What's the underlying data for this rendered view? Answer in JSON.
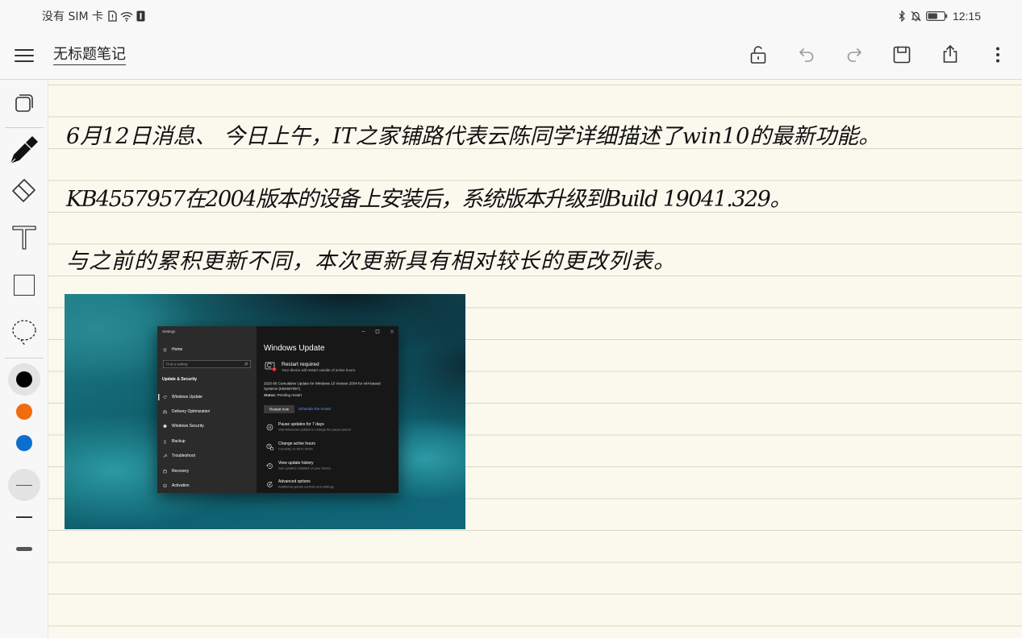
{
  "status_bar": {
    "carrier": "没有 SIM 卡",
    "time": "12:15",
    "battery_level": 0.6,
    "left_icons": [
      "sim-icon",
      "wifi-icon",
      "notification-icon"
    ],
    "right_icons": [
      "bluetooth-icon",
      "mute-icon",
      "battery-icon"
    ]
  },
  "toolbar": {
    "menu_icon": "menu-icon",
    "title": "无标题笔记",
    "actions": [
      "unlock-icon",
      "undo-icon",
      "redo-icon",
      "save-icon",
      "share-icon",
      "more-icon"
    ]
  },
  "tools": {
    "items": [
      "layers-icon",
      "pen-icon",
      "eraser-icon",
      "text-icon",
      "rectangle-icon",
      "lasso-icon"
    ],
    "selected": "pen-icon",
    "colors": [
      "#000000",
      "#f26b0f",
      "#0b6fce"
    ],
    "selected_color": "#000000",
    "stroke_widths": [
      "stroke-thin-icon",
      "stroke-medium-icon",
      "stroke-thick-icon"
    ],
    "selected_stroke": "stroke-thin-icon"
  },
  "theme": {
    "paper": "#fbf9ee",
    "rule": "#d9d6c6",
    "chrome": "#f8f8f8"
  },
  "note": {
    "lines": [
      "6月12日消息、 今日上午，IT之家铺路代表云陈同学详细描述了win10的最新功能。",
      "KB4557957在2004版本的设备上安装后，系统版本升级到Build 19041.329。",
      "与之前的累积更新不同，本次更新具有相对较长的更改列表。"
    ]
  },
  "embedded_image": {
    "window_title": "Settings",
    "window_controls": [
      "minimize-icon",
      "maximize-icon",
      "close-icon"
    ],
    "sidebar": {
      "home": "Home",
      "search_placeholder": "Find a setting",
      "section": "Update & Security",
      "items": [
        {
          "label": "Windows Update",
          "icon": "refresh-icon"
        },
        {
          "label": "Delivery Optimization",
          "icon": "delivery-icon"
        },
        {
          "label": "Windows Security",
          "icon": "shield-icon"
        },
        {
          "label": "Backup",
          "icon": "backup-icon"
        },
        {
          "label": "Troubleshoot",
          "icon": "wrench-icon"
        },
        {
          "label": "Recovery",
          "icon": "recovery-icon"
        },
        {
          "label": "Activation",
          "icon": "activation-icon"
        }
      ],
      "selected": "Windows Update"
    },
    "main": {
      "heading": "Windows Update",
      "restart_title": "Restart required",
      "restart_desc": "Your device will restart outside of active hours.",
      "update_name": "2020-06 Cumulative Update for Windows 10 Version 2004 for x64-based Systems (KB4557957)",
      "status_label": "Status:",
      "status_value": "Pending restart",
      "restart_button": "Restart now",
      "schedule_link": "Schedule the restart",
      "link_color": "#4aa3ff",
      "options": [
        {
          "title": "Pause updates for 7 days",
          "desc": "Visit Advanced options to change the pause period",
          "icon": "pause-icon"
        },
        {
          "title": "Change active hours",
          "desc": "Currently 11:00 to 04:00",
          "icon": "active-hours-icon"
        },
        {
          "title": "View update history",
          "desc": "See updates installed on your device",
          "icon": "history-icon"
        },
        {
          "title": "Advanced options",
          "desc": "Additional update controls and settings",
          "icon": "advanced-options-icon"
        }
      ]
    }
  }
}
